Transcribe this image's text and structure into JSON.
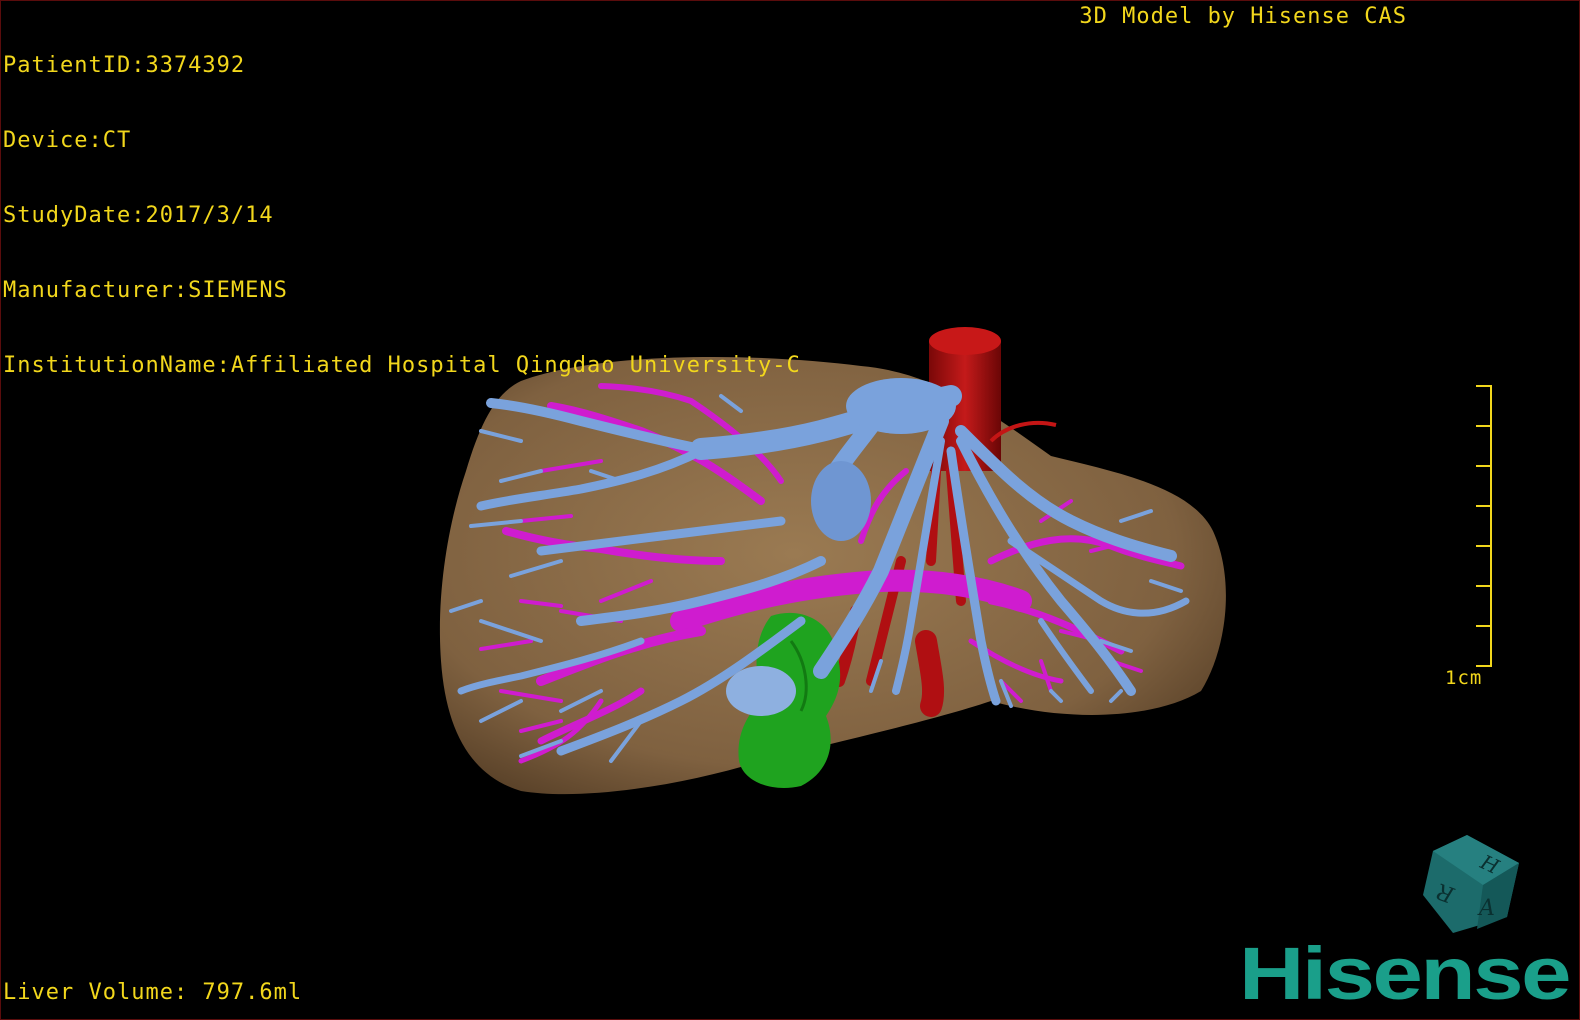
{
  "dicom": {
    "patient_id": "PatientID:3374392",
    "device": "Device:CT",
    "study_date": "StudyDate:2017/3/14",
    "manufacturer": "Manufacturer:SIEMENS",
    "institution": "InstitutionName:Affiliated Hospital Qingdao University-C"
  },
  "watermark": "3D Model by Hisense CAS",
  "liver_volume": "Liver Volume: 797.6ml",
  "scale": {
    "label": "1cm",
    "ticks": 8
  },
  "orientation_cube": {
    "faces": [
      "H",
      "R",
      "A"
    ],
    "color": "#1c6b6b"
  },
  "brand": {
    "name": "Hisense",
    "color": "#1a9f8a"
  },
  "colors": {
    "overlay_text": "#f2d71c",
    "liver": "#8a6a45",
    "portal_vein": "#6f9ad6",
    "hepatic_artery_or_vein": "#d21fd2",
    "ivc_artery": "#b00f12",
    "gallbladder": "#18a018"
  }
}
